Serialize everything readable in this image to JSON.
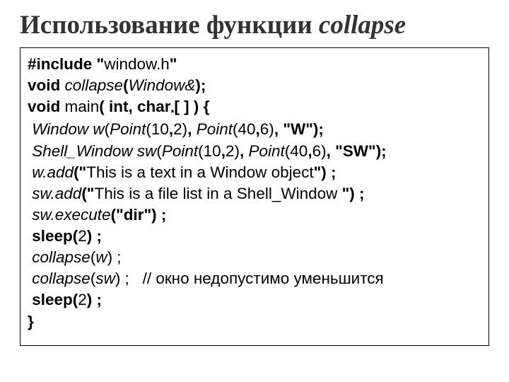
{
  "title_plain": "Использование функции ",
  "title_italic": "collapse",
  "code": {
    "l1": {
      "a": "#include \"",
      "b": "window.h",
      "c": "\""
    },
    "l2": {
      "a": "void ",
      "b": "collapse",
      "c": "(",
      "d": "Window&",
      "e": ");"
    },
    "l3": {
      "a": "void ",
      "b": "main",
      "c": "( int, char",
      "d": "*",
      "e": "[ ] ) {"
    },
    "l4": {
      "a": " Window w",
      "b": "(",
      "c": "Point",
      "d": "(10",
      "e": ",",
      "f": "2)",
      "g": ", ",
      "h": "Point",
      "i": "(40",
      "j": ",",
      "k": "6)",
      "l": ", \"W\");"
    },
    "l5": {
      "a": " Shell_Window sw",
      "b": "(",
      "c": "Point",
      "d": "(10",
      "e": ",",
      "f": "2)",
      "g": ", ",
      "h": "Point",
      "i": "(40",
      "j": ",",
      "k": "6)",
      "l": ", \"SW\");"
    },
    "l6": {
      "a": " w.add",
      "b": "(\"",
      "c": "This is a text in a Window object",
      "d": "\") ;"
    },
    "l7": {
      "a": " sw.add",
      "b": "(\"",
      "c": "This is a file list in a Shell_Window ",
      "d": "\") ;"
    },
    "l8": {
      "a": " sw.execute",
      "b": "(\"dir\") ;"
    },
    "l9": {
      "a": " sleep(",
      "b": "2",
      "c": ") ;"
    },
    "l10": {
      "a": " collapse",
      "b": "(",
      "c": "w",
      "d": ") ;"
    },
    "l11a": {
      "a": " collapse",
      "b": "(",
      "c": "sw",
      "d": ") ;"
    },
    "l11b": "   // окно недопустимо уменьшится",
    "l12": {
      "a": " sleep(",
      "b": "2",
      "c": ") ;"
    },
    "l13": "}"
  }
}
